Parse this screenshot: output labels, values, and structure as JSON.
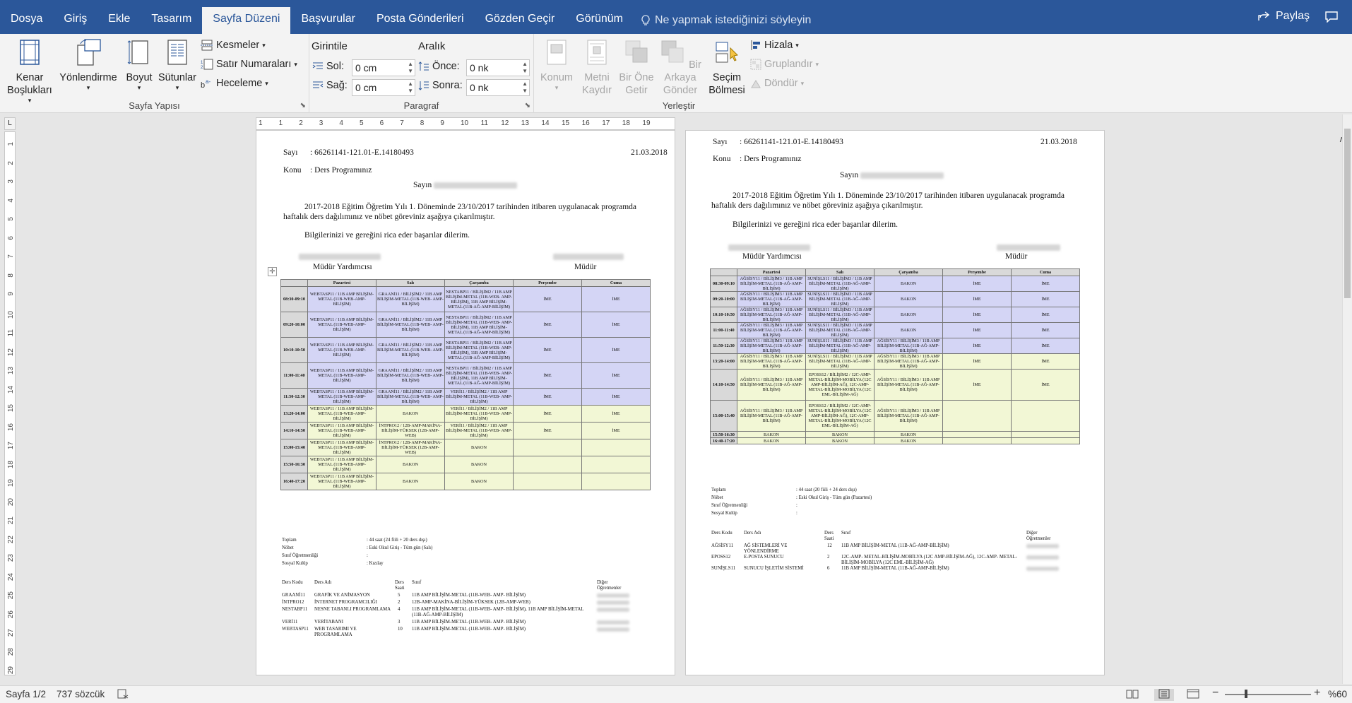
{
  "tabs": [
    "Dosya",
    "Giriş",
    "Ekle",
    "Tasarım",
    "Sayfa Düzeni",
    "Başvurular",
    "Posta Gönderileri",
    "Gözden Geçir",
    "Görünüm"
  ],
  "tell_me": "Ne yapmak istediğinizi söyleyin",
  "share": "Paylaş",
  "ribbon": {
    "page_setup": {
      "title": "Sayfa Yapısı",
      "margins": "Kenar\nBoşlukları",
      "orientation": "Yönlendirme",
      "size": "Boyut",
      "columns": "Sütunlar",
      "breaks": "Kesmeler",
      "line_numbers": "Satır Numaraları",
      "hyphenation": "Heceleme"
    },
    "paragraph": {
      "title": "Paragraf",
      "indent": "Girintile",
      "spacing": "Aralık",
      "left": "Sol:",
      "right": "Sağ:",
      "before": "Önce:",
      "after": "Sonra:",
      "left_val": "0 cm",
      "right_val": "0 cm",
      "before_val": "0 nk",
      "after_val": "0 nk"
    },
    "arrange": {
      "title": "Yerleştir",
      "position": "Konum",
      "wrap": "Metni\nKaydır",
      "forward": "Bir Öne\nGetir",
      "backward": "Bir Arkaya\nGönder",
      "selection": "Seçim\nBölmesi",
      "align": "Hizala",
      "group": "Gruplandır",
      "rotate": "Döndür"
    }
  },
  "ruler_h": [
    "1",
    "1",
    "2",
    "3",
    "4",
    "5",
    "6",
    "7",
    "8",
    "9",
    "10",
    "11",
    "12",
    "13",
    "14",
    "15",
    "16",
    "17",
    "18",
    "19"
  ],
  "ruler_v": [
    "1",
    "2",
    "3",
    "4",
    "5",
    "6",
    "7",
    "8",
    "9",
    "10",
    "11",
    "12",
    "13",
    "14",
    "15",
    "16",
    "17",
    "18",
    "19",
    "20",
    "21",
    "22",
    "23",
    "24",
    "25",
    "26",
    "27",
    "28",
    "29"
  ],
  "page1": {
    "sayi": "Sayı",
    "sayi_val": ": 66261141-121.01-E.14180493",
    "date": "21.03.2018",
    "konu": "Konu",
    "konu_val": ": Ders Programınız",
    "sayin": "Sayın",
    "body": "2017-2018 Eğitim Öğretim Yılı 1. Döneminde 23/10/2017 tarihinden itibaren uygulanacak programda haftalık ders dağılımınız ve nöbet göreviniz aşağıya çıkarılmıştır.",
    "closing": "Bilgilerinizi ve gereğini rica eder başarılar dilerim.",
    "left_title": "Müdür Yardımcısı",
    "right_title": "Müdür",
    "headers": [
      "",
      "Pazartesi",
      "Salı",
      "Çarşamba",
      "Perşembe",
      "Cuma"
    ],
    "rows": [
      {
        "t": "08:30-09:10",
        "c": [
          "WEBTASP11 / 11B AMP BİLİŞİM-METAL (11B-WEB-AMP- BİLİŞİM)",
          "GRAANİ11 / BİLİŞİM2 / 11B AMP BİLİŞİM-METAL (11B-WEB- AMP- BİLİŞİM)",
          "NESTABP11 / BİLİŞİM2 / 11B AMP BİLİŞİM-METAL (11B-WEB- AMP- BİLİŞİM), 11B AMP BİLİŞİM-METAL (11B-AĞ-AMP-BİLİŞİM)",
          "İME",
          "İME"
        ],
        "pm": false
      },
      {
        "t": "09:20-10:00",
        "c": [
          "WEBTASP11 / 11B AMP BİLİŞİM-METAL (11B-WEB-AMP- BİLİŞİM)",
          "GRAANİ11 / BİLİŞİM2 / 11B AMP BİLİŞİM-METAL (11B-WEB- AMP- BİLİŞİM)",
          "NESTABP11 / BİLİŞİM2 / 11B AMP BİLİŞİM-METAL (11B-WEB- AMP- BİLİŞİM), 11B AMP BİLİŞİM-METAL (11B-AĞ-AMP-BİLİŞİM)",
          "İME",
          "İME"
        ],
        "pm": false
      },
      {
        "t": "10:10-10:50",
        "c": [
          "WEBTASP11 / 11B AMP BİLİŞİM-METAL (11B-WEB-AMP- BİLİŞİM)",
          "GRAANİ11 / BİLİŞİM2 / 11B AMP BİLİŞİM-METAL (11B-WEB- AMP- BİLİŞİM)",
          "NESTABP11 / BİLİŞİM2 / 11B AMP BİLİŞİM-METAL (11B-WEB- AMP- BİLİŞİM), 11B AMP BİLİŞİM-METAL (11B-AĞ-AMP-BİLİŞİM)",
          "İME",
          "İME"
        ],
        "pm": false
      },
      {
        "t": "11:00-11:40",
        "c": [
          "WEBTASP11 / 11B AMP BİLİŞİM-METAL (11B-WEB-AMP- BİLİŞİM)",
          "GRAANİ11 / BİLİŞİM2 / 11B AMP BİLİŞİM-METAL (11B-WEB- AMP- BİLİŞİM)",
          "NESTABP11 / BİLİŞİM2 / 11B AMP BİLİŞİM-METAL (11B-WEB- AMP- BİLİŞİM), 11B AMP BİLİŞİM-METAL (11B-AĞ-AMP-BİLİŞİM)",
          "İME",
          "İME"
        ],
        "pm": false
      },
      {
        "t": "11:50-12:30",
        "c": [
          "WEBTASP11 / 11B AMP BİLİŞİM-METAL (11B-WEB-AMP- BİLİŞİM)",
          "GRAANİ11 / BİLİŞİM2 / 11B AMP BİLİŞİM-METAL (11B-WEB- AMP- BİLİŞİM)",
          "VERİ11 / BİLİŞİM2 / 11B AMP BİLİŞİM-METAL (11B-WEB- AMP- BİLİŞİM)",
          "İME",
          "İME"
        ],
        "pm": false
      },
      {
        "t": "13:20-14:00",
        "c": [
          "WEBTASP11 / 11B AMP BİLİŞİM-METAL (11B-WEB-AMP- BİLİŞİM)",
          "BAKON",
          "VERİ11 / BİLİŞİM2 / 11B AMP BİLİŞİM-METAL (11B-WEB- AMP- BİLİŞİM)",
          "İME",
          "İME"
        ],
        "pm": true
      },
      {
        "t": "14:10-14:50",
        "c": [
          "WEBTASP11 / 11B AMP BİLİŞİM-METAL (11B-WEB-AMP- BİLİŞİM)",
          "İNTPRO12 / 12B-AMP-MAKİNA-BİLİŞİM-YÜKSEK (12B-AMP-WEB)",
          "VERİ11 / BİLİŞİM2 / 11B AMP BİLİŞİM-METAL (11B-WEB- AMP- BİLİŞİM)",
          "İME",
          "İME"
        ],
        "pm": true
      },
      {
        "t": "15:00-15:40",
        "c": [
          "WEBTASP11 / 11B AMP BİLİŞİM-METAL (11B-WEB-AMP- BİLİŞİM)",
          "İNTPRO12 / 12B-AMP-MAKİNA-BİLİŞİM-YÜKSEK (12B-AMP-WEB)",
          "BAKON",
          "",
          ""
        ],
        "pm": true
      },
      {
        "t": "15:50-16:30",
        "c": [
          "WEBTASP11 / 11B AMP BİLİŞİM-METAL (11B-WEB-AMP- BİLİŞİM)",
          "BAKON",
          "BAKON",
          "",
          ""
        ],
        "pm": true
      },
      {
        "t": "16:40-17:20",
        "c": [
          "WEBTASP11 / 11B AMP BİLİŞİM-METAL (11B-WEB-AMP- BİLİŞİM)",
          "BAKON",
          "BAKON",
          "",
          ""
        ],
        "pm": true
      }
    ],
    "info": [
      [
        "Toplam",
        ": 44 saat (24 fiili + 20 ders dışı)"
      ],
      [
        "Nöbet",
        ": Eski Okul Giriş - Tüm gün (Salı)"
      ],
      [
        "Sınıf Öğretmenliği",
        ":"
      ],
      [
        "Sosyal Kulüp",
        ": Kızılay"
      ]
    ],
    "course_headers": [
      "Ders Kodu",
      "Ders Adı",
      "Ders Saati",
      "Sınıf",
      "Diğer Öğretmenler"
    ],
    "courses": [
      [
        "GRAANİ11",
        "GRAFİK VE ANİMASYON",
        "5",
        "11B AMP BİLİŞİM-METAL (11B-WEB- AMP- BİLİŞİM)"
      ],
      [
        "İNTPRO12",
        "İNTERNET PROGRAMCILIĞI",
        "2",
        "12B-AMP-MAKİNA-BİLİŞİM-YÜKSEK (12B-AMP-WEB)"
      ],
      [
        "NESTABP11",
        "NESNE TABANLI PROGRAMLAMA",
        "4",
        "11B AMP BİLİŞİM-METAL (11B-WEB- AMP- BİLİŞİM), 11B AMP BİLİŞİM-METAL (11B-AĞ-AMP-BİLİŞİM)"
      ],
      [
        "VERİ11",
        "VERİTABANI",
        "3",
        "11B AMP BİLİŞİM-METAL (11B-WEB- AMP- BİLİŞİM)"
      ],
      [
        "WEBTASP11",
        "WEB TASARIMI VE PROGRAMLAMA",
        "10",
        "11B AMP BİLİŞİM-METAL (11B-WEB- AMP- BİLİŞİM)"
      ]
    ]
  },
  "page2": {
    "sayi": "Sayı",
    "sayi_val": ": 66261141-121.01-E.14180493",
    "date": "21.03.2018",
    "konu": "Konu",
    "konu_val": ": Ders Programınız",
    "sayin": "Sayın",
    "body": "2017-2018 Eğitim Öğretim Yılı 1. Döneminde 23/10/2017 tarihinden itibaren uygulanacak programda haftalık ders dağılımınız ve nöbet göreviniz aşağıya çıkarılmıştır.",
    "closing": "Bilgilerinizi ve gereğini rica eder başarılar dilerim.",
    "left_title": "Müdür Yardımcısı",
    "right_title": "Müdür",
    "headers": [
      "",
      "Pazartesi",
      "Salı",
      "Çarşamba",
      "Perşembe",
      "Cuma"
    ],
    "rows": [
      {
        "t": "08:30-09:10",
        "c": [
          "AĞSİSY11 / BİLİŞİM3 / 11B AMP BİLİŞİM-METAL (11B-AĞ-AMP-BİLİŞİM)",
          "SUNİŞLS11 / BİLİŞİM3 / 11B AMP BİLİŞİM-METAL (11B-AĞ-AMP-BİLİŞİM)",
          "BAKON",
          "İME",
          "İME"
        ],
        "pm": false
      },
      {
        "t": "09:20-10:00",
        "c": [
          "AĞSİSY11 / BİLİŞİM3 / 11B AMP BİLİŞİM-METAL (11B-AĞ-AMP-BİLİŞİM)",
          "SUNİŞLS11 / BİLİŞİM3 / 11B AMP BİLİŞİM-METAL (11B-AĞ-AMP-BİLİŞİM)",
          "BAKON",
          "İME",
          "İME"
        ],
        "pm": false
      },
      {
        "t": "10:10-10:50",
        "c": [
          "AĞSİSY11 / BİLİŞİM3 / 11B AMP BİLİŞİM-METAL (11B-AĞ-AMP-BİLİŞİM)",
          "SUNİŞLS11 / BİLİŞİM3 / 11B AMP BİLİŞİM-METAL (11B-AĞ-AMP-BİLİŞİM)",
          "BAKON",
          "İME",
          "İME"
        ],
        "pm": false
      },
      {
        "t": "11:00-11:40",
        "c": [
          "AĞSİSY11 / BİLİŞİM3 / 11B AMP BİLİŞİM-METAL (11B-AĞ-AMP-BİLİŞİM)",
          "SUNİŞLS11 / BİLİŞİM3 / 11B AMP BİLİŞİM-METAL (11B-AĞ-AMP-BİLİŞİM)",
          "BAKON",
          "İME",
          "İME"
        ],
        "pm": false
      },
      {
        "t": "11:50-12:30",
        "c": [
          "AĞSİSY11 / BİLİŞİM3 / 11B AMP BİLİŞİM-METAL (11B-AĞ-AMP-BİLİŞİM)",
          "SUNİŞLS11 / BİLİŞİM3 / 11B AMP BİLİŞİM-METAL (11B-AĞ-AMP-BİLİŞİM)",
          "AĞSİSY11 / BİLİŞİM3 / 11B AMP BİLİŞİM-METAL (11B-AĞ-AMP-BİLİŞİM)",
          "İME",
          "İME"
        ],
        "pm": false
      },
      {
        "t": "13:20-14:00",
        "c": [
          "AĞSİSY11 / BİLİŞİM3 / 11B AMP BİLİŞİM-METAL (11B-AĞ-AMP-BİLİŞİM)",
          "SUNİŞLS11 / BİLİŞİM3 / 11B AMP BİLİŞİM-METAL (11B-AĞ-AMP-BİLİŞİM)",
          "AĞSİSY11 / BİLİŞİM3 / 11B AMP BİLİŞİM-METAL (11B-AĞ-AMP-BİLİŞİM)",
          "İME",
          "İME"
        ],
        "pm": true
      },
      {
        "t": "14:10-14:50",
        "c": [
          "AĞSİSY11 / BİLİŞİM3 / 11B AMP BİLİŞİM-METAL (11B-AĞ-AMP-BİLİŞİM)",
          "EPOSS12 / BİLİŞİM2 / 12C-AMP- METAL-BİLİŞİM-MOBİLYA (12C AMP-BİLİŞİM-AĞ), 12C-AMP-METAL-BİLİŞİM-MOBİLYA (12C EML-BİLİŞİM-AĞ)",
          "AĞSİSY11 / BİLİŞİM3 / 11B AMP BİLİŞİM-METAL (11B-AĞ-AMP-BİLİŞİM)",
          "İME",
          "İME"
        ],
        "pm": true
      },
      {
        "t": "15:00-15:40",
        "c": [
          "AĞSİSY11 / BİLİŞİM3 / 11B AMP BİLİŞİM-METAL (11B-AĞ-AMP-BİLİŞİM)",
          "EPOSS12 / BİLİŞİM2 / 12C-AMP- METAL-BİLİŞİM-MOBİLYA (12C AMP-BİLİŞİM-AĞ), 12C-AMP-METAL-BİLİŞİM-MOBİLYA (12C EML-BİLİŞİM-AĞ)",
          "AĞSİSY11 / BİLİŞİM3 / 11B AMP BİLİŞİM-METAL (11B-AĞ-AMP-BİLİŞİM)",
          "",
          ""
        ],
        "pm": true
      },
      {
        "t": "15:50-16:30",
        "c": [
          "BAKON",
          "BAKON",
          "BAKON",
          "",
          ""
        ],
        "pm": true
      },
      {
        "t": "16:40-17:20",
        "c": [
          "BAKON",
          "BAKON",
          "BAKON",
          "",
          ""
        ],
        "pm": true
      }
    ],
    "info": [
      [
        "Toplam",
        ": 44 saat (20 fiili + 24 ders dışı)"
      ],
      [
        "Nöbet",
        ": Eski Okul Giriş - Tüm gün (Pazartesi)"
      ],
      [
        "Sınıf Öğretmenliği",
        ":"
      ],
      [
        "Sosyal Kulüp",
        ":"
      ]
    ],
    "course_headers": [
      "Ders Kodu",
      "Ders Adı",
      "Ders Saati",
      "Sınıf",
      "Diğer Öğretmenler"
    ],
    "courses": [
      [
        "AĞSİSY11",
        "AĞ SİSTEMLERİ VE YÖNLENDİRME",
        "12",
        "11B AMP BİLİŞİM-METAL (11B-AĞ-AMP-BİLİŞİM)"
      ],
      [
        "EPOSS12",
        "E-POSTA SUNUCU",
        "2",
        "12C-AMP- METAL-BİLİŞİM-MOBİLYA (12C AMP-BİLİŞİM-AĞ), 12C-AMP- METAL-BİLİŞİM-MOBİLYA (12C EML-BİLİŞİM-AĞ)"
      ],
      [
        "SUNİŞLS11",
        "SUNUCU İŞLETİM SİSTEMİ",
        "6",
        "11B AMP BİLİŞİM-METAL (11B-AĞ-AMP-BİLİŞİM)"
      ]
    ]
  },
  "status": {
    "page": "Sayfa 1/2",
    "words": "737 sözcük",
    "zoom": "%60"
  },
  "colors": {
    "accent": "#2b579a",
    "am_row": "#d4d5f5",
    "pm_row": "#f2f7d5"
  }
}
